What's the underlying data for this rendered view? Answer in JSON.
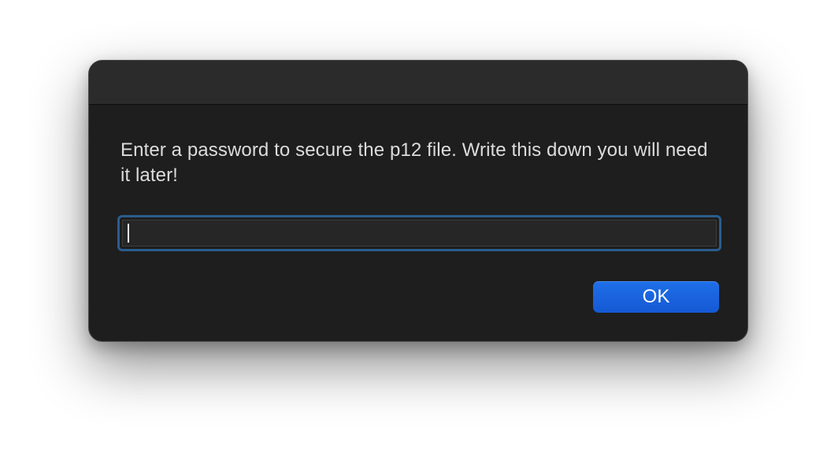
{
  "dialog": {
    "message": "Enter a password to secure the p12 file. Write this down you will need it later!",
    "password_field": {
      "value": "",
      "placeholder": ""
    },
    "ok_label": "OK"
  },
  "colors": {
    "dialog_background": "#1e1e1e",
    "titlebar_background": "#2b2b2b",
    "focus_ring": "#2a5d8c",
    "accent_button": "#1f6fe8",
    "message_text": "#dcdcdc"
  }
}
